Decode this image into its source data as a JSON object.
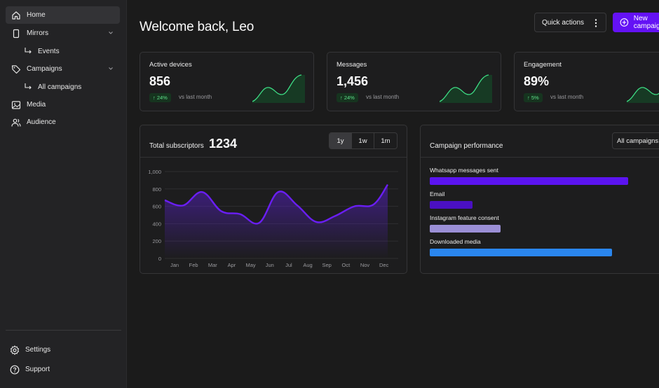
{
  "sidebar": {
    "items": [
      {
        "label": "Home"
      },
      {
        "label": "Mirrors"
      },
      {
        "label": "Events"
      },
      {
        "label": "Campaigns"
      },
      {
        "label": "All campaigns"
      },
      {
        "label": "Media"
      },
      {
        "label": "Audience"
      }
    ],
    "bottom": [
      {
        "label": "Settings"
      },
      {
        "label": "Support"
      }
    ]
  },
  "header": {
    "title": "Welcome back, Leo",
    "quick_actions": "Quick actions",
    "new_campaign": "New campaign"
  },
  "stats": [
    {
      "label": "Active devices",
      "value": "856",
      "change": "↑ 24%",
      "vs": "vs last month"
    },
    {
      "label": "Messages",
      "value": "1,456",
      "change": "↑ 24%",
      "vs": "vs last month"
    },
    {
      "label": "Engagement",
      "value": "89%",
      "change": "↑ 5%",
      "vs": "vs last month"
    }
  ],
  "subscribers": {
    "label": "Total subscriptors",
    "value": "1234",
    "ranges": [
      "1y",
      "1w",
      "1m"
    ],
    "selected_range": "1y"
  },
  "campaign_performance": {
    "title": "Campaign performance",
    "filter": "All campaigns"
  },
  "colors": {
    "accent": "#6412f5",
    "positive": "#5fe08a",
    "sparkline": "#3ddc84"
  },
  "chart_data": [
    {
      "type": "area",
      "title": "",
      "categories": [
        "Jan",
        "Feb",
        "Mar",
        "Apr",
        "May",
        "Jun",
        "Jul",
        "Aug",
        "Sep",
        "Oct",
        "Nov",
        "Dec"
      ],
      "x": [
        0,
        1,
        2,
        3,
        4,
        5,
        6,
        7,
        8,
        9,
        10,
        11,
        11.75
      ],
      "values": [
        670,
        610,
        765,
        545,
        510,
        410,
        765,
        610,
        420,
        490,
        600,
        620,
        850
      ],
      "ylim": [
        0,
        1000
      ],
      "yticks": [
        "0",
        "200",
        "400",
        "600",
        "800",
        "1,000"
      ],
      "color": "#6a1ef5",
      "grid": true
    },
    {
      "type": "bar",
      "orientation": "horizontal",
      "title": "",
      "categories": [
        "Whatsapp messages sent",
        "Email",
        "Instagram feature consent",
        "Downloaded media"
      ],
      "values": [
        283,
        61,
        101,
        260
      ],
      "colors": [
        "#5b14f0",
        "#4a10c2",
        "#9b8fd6",
        "#2a86ee"
      ]
    }
  ]
}
